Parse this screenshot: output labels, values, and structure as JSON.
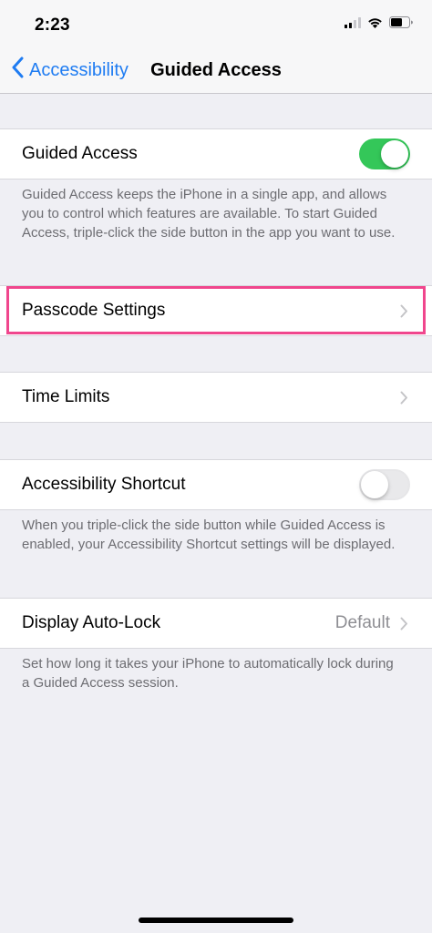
{
  "status_bar": {
    "time": "2:23"
  },
  "nav": {
    "back_label": "Accessibility",
    "title": "Guided Access"
  },
  "guided_access": {
    "label": "Guided Access",
    "toggle_on": true,
    "footer": "Guided Access keeps the iPhone in a single app, and allows you to control which features are available. To start Guided Access, triple-click the side button in the app you want to use."
  },
  "passcode_settings": {
    "label": "Passcode Settings"
  },
  "time_limits": {
    "label": "Time Limits"
  },
  "accessibility_shortcut": {
    "label": "Accessibility Shortcut",
    "toggle_on": false,
    "footer": "When you triple-click the side button while Guided Access is enabled, your Accessibility Shortcut settings will be displayed."
  },
  "display_auto_lock": {
    "label": "Display Auto-Lock",
    "value": "Default",
    "footer": "Set how long it takes your iPhone to automatically lock during a Guided Access session."
  },
  "colors": {
    "accent": "#1f7cf2",
    "toggle_on": "#34c759",
    "highlight": "#f0468d",
    "background": "#efeff4"
  },
  "icons": {
    "signal": "cellular-signal-icon",
    "wifi": "wifi-icon",
    "battery": "battery-icon",
    "back": "chevron-left-icon",
    "disclosure": "chevron-right-icon"
  }
}
